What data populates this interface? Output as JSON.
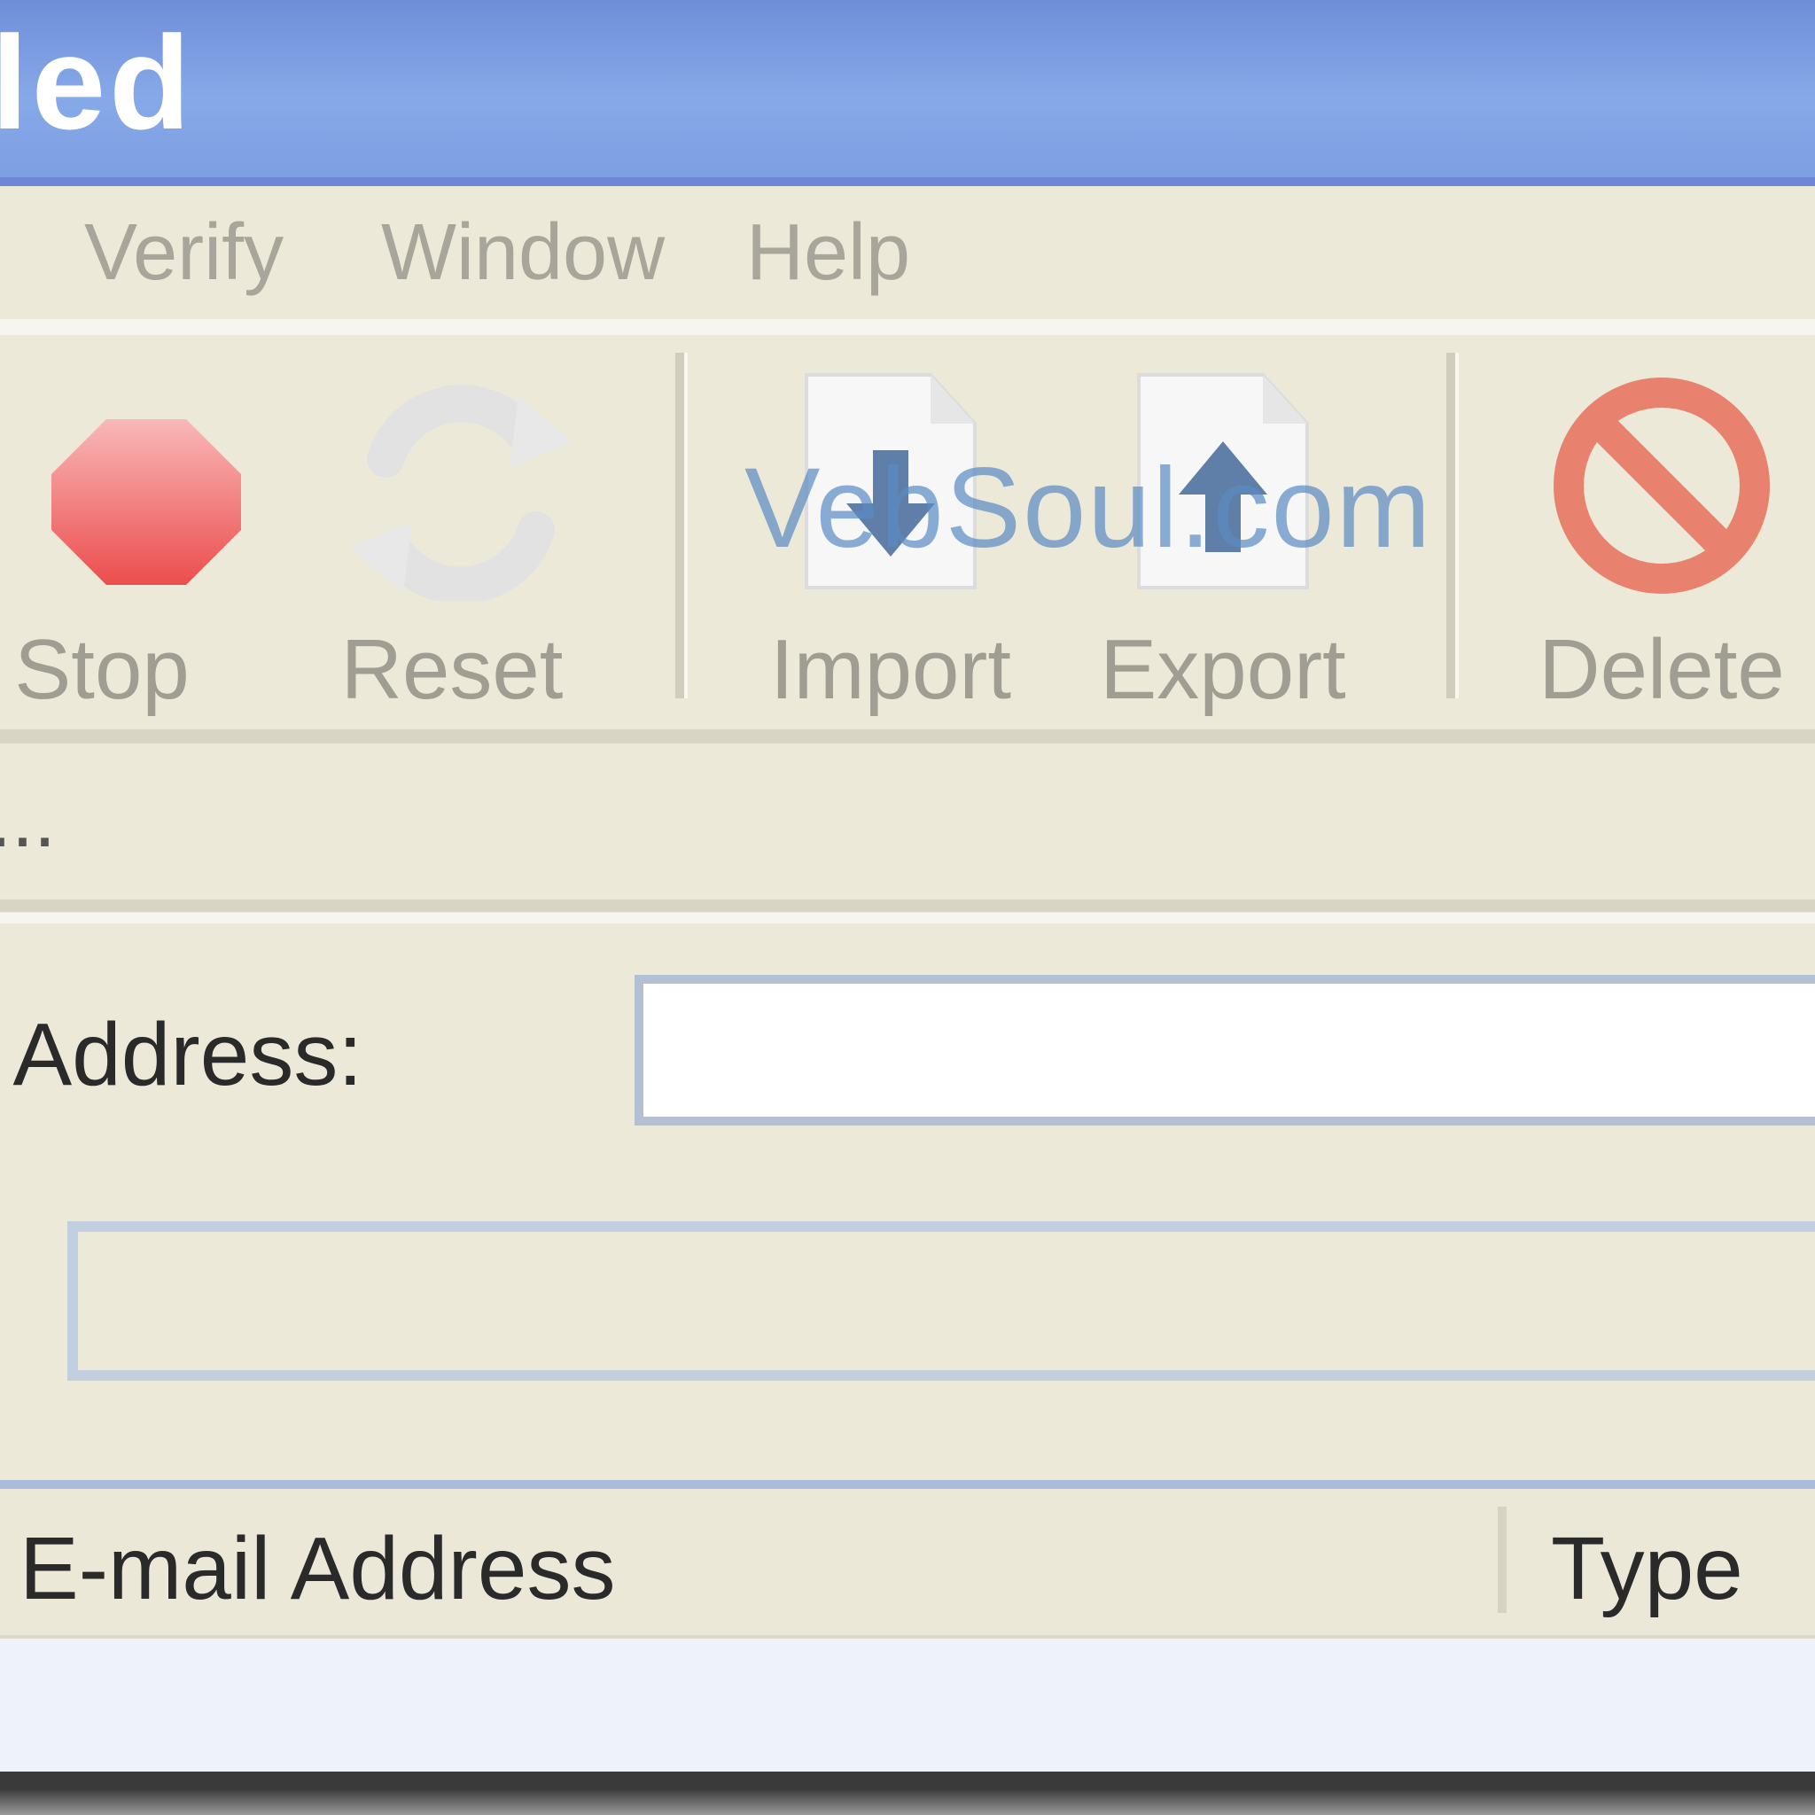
{
  "window": {
    "title_fragment": "led"
  },
  "menu": {
    "items": [
      "Verify",
      "Window",
      "Help"
    ]
  },
  "toolbar": {
    "buttons": [
      {
        "label": "Stop",
        "icon": "stop-icon"
      },
      {
        "label": "Reset",
        "icon": "reset-icon"
      },
      {
        "label": "Import",
        "icon": "import-icon"
      },
      {
        "label": "Export",
        "icon": "export-icon"
      },
      {
        "label": "Delete",
        "icon": "delete-icon"
      }
    ],
    "watermark": "VebSoul.com"
  },
  "status": {
    "text": "..."
  },
  "form": {
    "address_label": "l Address:",
    "address_value": ""
  },
  "list": {
    "columns": [
      "E-mail Address",
      "Type"
    ]
  },
  "colors": {
    "title_bar": "#7e9fe3",
    "face": "#ece9d8",
    "stop_red": "#ee5555",
    "delete_red": "#e8826e",
    "accent_blue": "#5a8bc4"
  }
}
